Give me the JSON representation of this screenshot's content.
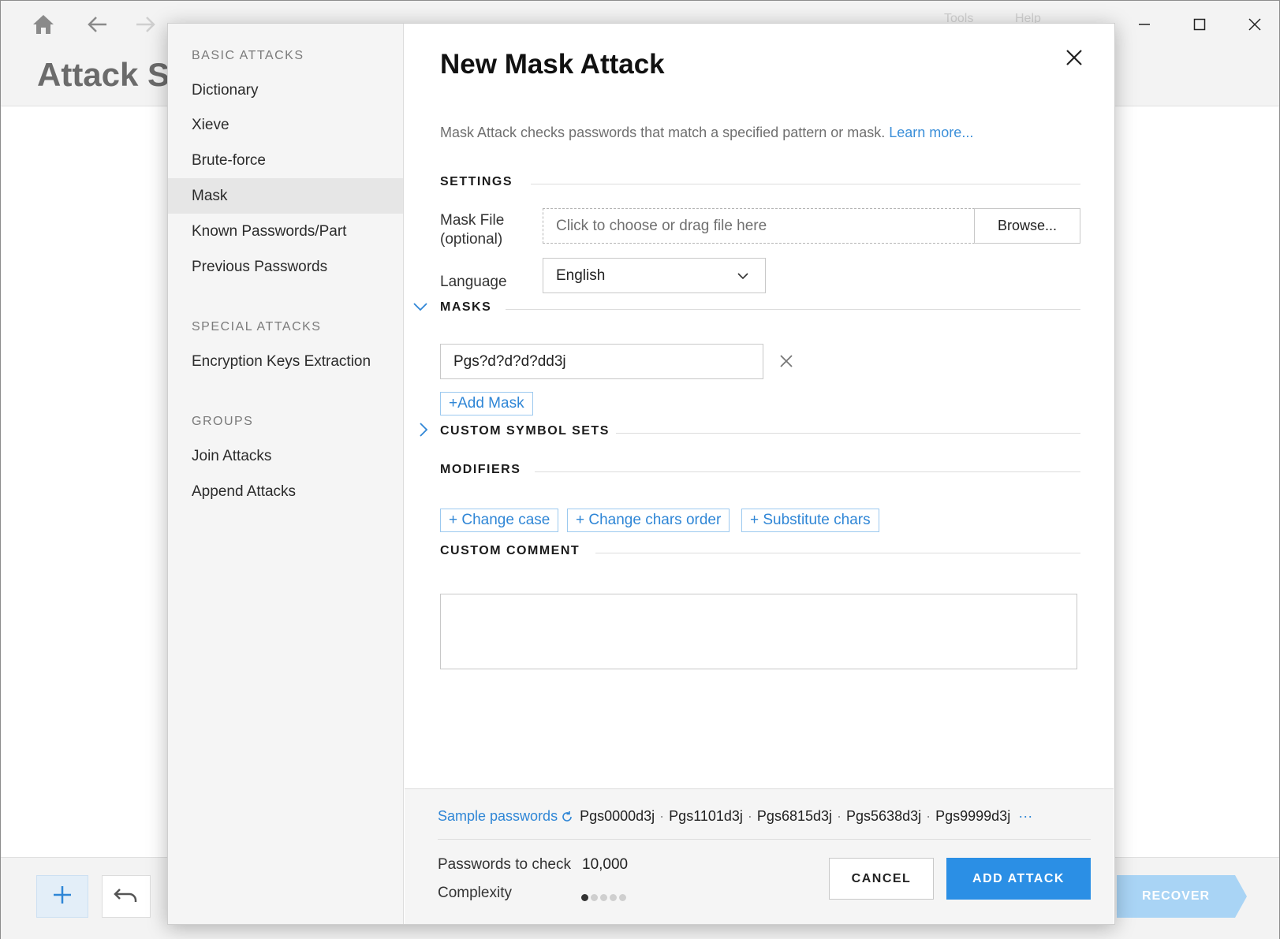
{
  "app": {
    "title": "Attack Se",
    "menu_tools": "Tools",
    "menu_help": "Help",
    "recover_label": "RECOVER"
  },
  "sidebar": {
    "sections": [
      {
        "title": "BASIC ATTACKS",
        "items": [
          "Dictionary",
          "Xieve",
          "Brute-force",
          "Mask",
          "Known Passwords/Part",
          "Previous Passwords"
        ]
      },
      {
        "title": "SPECIAL ATTACKS",
        "items": [
          "Encryption Keys Extraction"
        ]
      },
      {
        "title": "GROUPS",
        "items": [
          "Join Attacks",
          "Append Attacks"
        ]
      }
    ],
    "active_item": "Mask"
  },
  "dialog": {
    "title": "New Mask Attack",
    "description": "Mask Attack checks passwords that match a specified pattern or mask.",
    "learn_more": "Learn more...",
    "settings": {
      "heading": "SETTINGS",
      "mask_file_label_line1": "Mask File",
      "mask_file_label_line2": "(optional)",
      "mask_file_placeholder": "Click to choose or drag file here",
      "browse_label": "Browse...",
      "language_label": "Language",
      "language_value": "English"
    },
    "masks": {
      "heading": "MASKS",
      "items": [
        "Pgs?d?d?d?dd3j"
      ],
      "add_label": "+Add Mask"
    },
    "custom_symbol_sets": {
      "heading": "CUSTOM SYMBOL SETS"
    },
    "modifiers": {
      "heading": "MODIFIERS",
      "buttons": [
        "+ Change case",
        "+ Change chars order",
        "+ Substitute chars"
      ]
    },
    "custom_comment": {
      "heading": "CUSTOM COMMENT",
      "value": ""
    },
    "footer": {
      "sample_label": "Sample passwords",
      "samples": [
        "Pgs0000d3j",
        "Pgs1101d3j",
        "Pgs6815d3j",
        "Pgs5638d3j",
        "Pgs9999d3j"
      ],
      "more": "···",
      "passwords_label": "Passwords to check",
      "passwords_value": "10,000",
      "complexity_label": "Complexity",
      "complexity_level": 1,
      "complexity_max": 5,
      "cancel_label": "CANCEL",
      "add_label": "ADD ATTACK"
    }
  },
  "colors": {
    "accent": "#2b8fe5",
    "link": "#2f86d6",
    "recover": "#a9d4f5"
  }
}
